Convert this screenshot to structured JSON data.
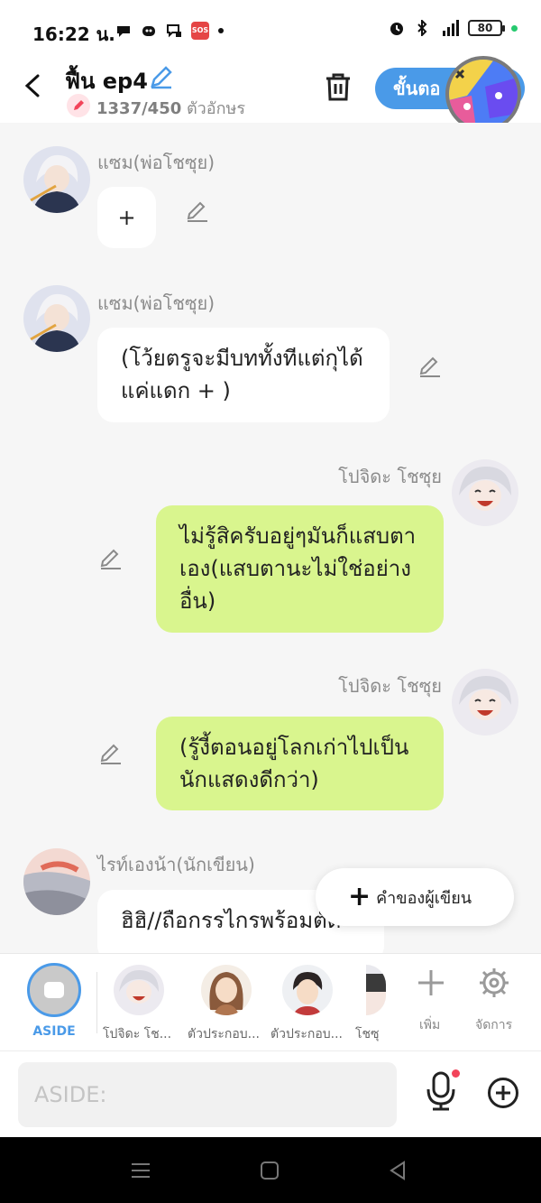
{
  "status_bar": {
    "time": "16:22 น.",
    "battery": "80",
    "network": "4G"
  },
  "header": {
    "title": "ฟื้น ep4",
    "char_count": "1337/450",
    "char_unit": "ตัวอักษร",
    "next_button": "ขั้นตอ"
  },
  "messages": [
    {
      "speaker": "แซม(พ่อโชซุย)",
      "text": "+"
    },
    {
      "speaker": "แซม(พ่อโชซุย)",
      "text": "(โว้ยตรูจะมีบททั้งทีแต่กุได้แค่แดก + )"
    },
    {
      "speaker": "โปจิดะ โชซุย",
      "text": "ไม่รู้สิครับอยู่ๆมันก็แสบตาเอง(แสบตานะไม่ใช่อย่างอื่น)"
    },
    {
      "speaker": "โปจิดะ โชซุย",
      "text": "(รู้งี้ตอนอยู่โลกเก่าไปเป็นนักแสดงดีกว่า)"
    },
    {
      "speaker": "ไรท์เองน้า(นักเขียน)",
      "text": "ฮิฮิ//ถือกรรไกรพร้อมตัด"
    }
  ],
  "author_button": "คำของผู้เขียน",
  "character_bar": {
    "aside_label": "ASIDE",
    "characters": [
      "โปจิดะ โช...",
      "ตัวประกอบ...",
      "ตัวประกอบ...",
      "โชซุ"
    ],
    "add_label": "เพิ่ม",
    "manage_label": "จัดการ"
  },
  "input": {
    "placeholder": "ASIDE:"
  },
  "colors": {
    "accent": "#4a9ae8",
    "right_bubble": "#d9f58e",
    "left_bubble": "#ffffff"
  }
}
